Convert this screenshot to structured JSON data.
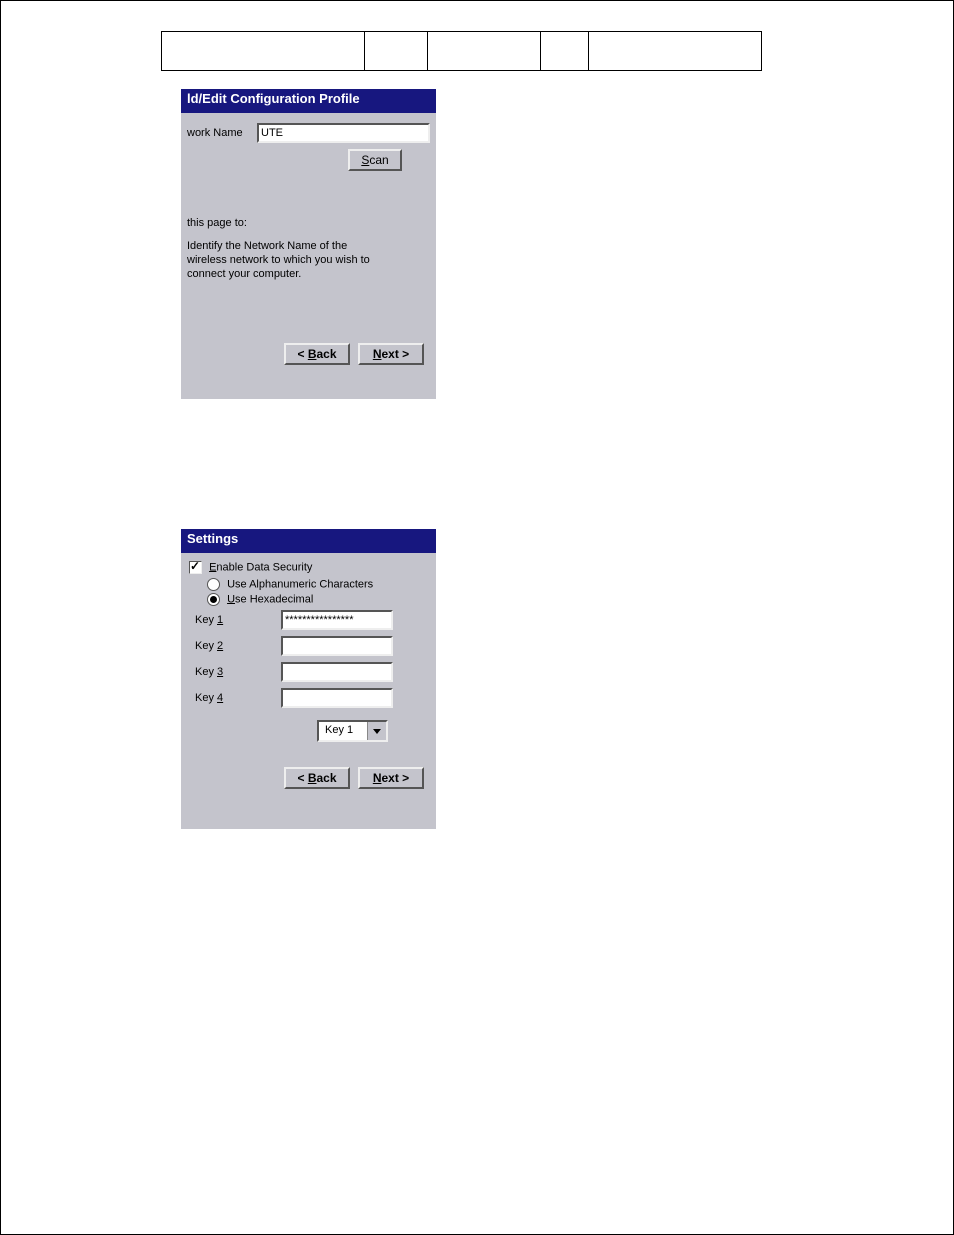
{
  "dialog1": {
    "title": "ld/Edit Configuration Profile",
    "network_name_label": "work Name",
    "network_name_value": "UTE",
    "scan_label_pre": "S",
    "scan_label_post": "can",
    "section_head": "this page to:",
    "description": "Identify the Network Name of the wireless network to which you wish to connect your computer.",
    "back_pre": "< ",
    "back_ul": "B",
    "back_post": "ack",
    "next_ul": "N",
    "next_post": "ext >"
  },
  "dialog2": {
    "title": "Settings",
    "enable_pre": "E",
    "enable_post": "nable Data Security",
    "opt_alpha": "Use Alphanumeric Characters",
    "opt_hex_pre": "U",
    "opt_hex_post": "se Hexadecimal",
    "keys": [
      {
        "label_pre": "Key ",
        "label_ul": "1",
        "value": "****************"
      },
      {
        "label_pre": "Key ",
        "label_ul": "2",
        "value": ""
      },
      {
        "label_pre": "Key ",
        "label_ul": "3",
        "value": ""
      },
      {
        "label_pre": "Key ",
        "label_ul": "4",
        "value": ""
      }
    ],
    "combo_value": "Key 1",
    "back_pre": "< ",
    "back_ul": "B",
    "back_post": "ack",
    "next_ul": "N",
    "next_post": "ext >"
  }
}
